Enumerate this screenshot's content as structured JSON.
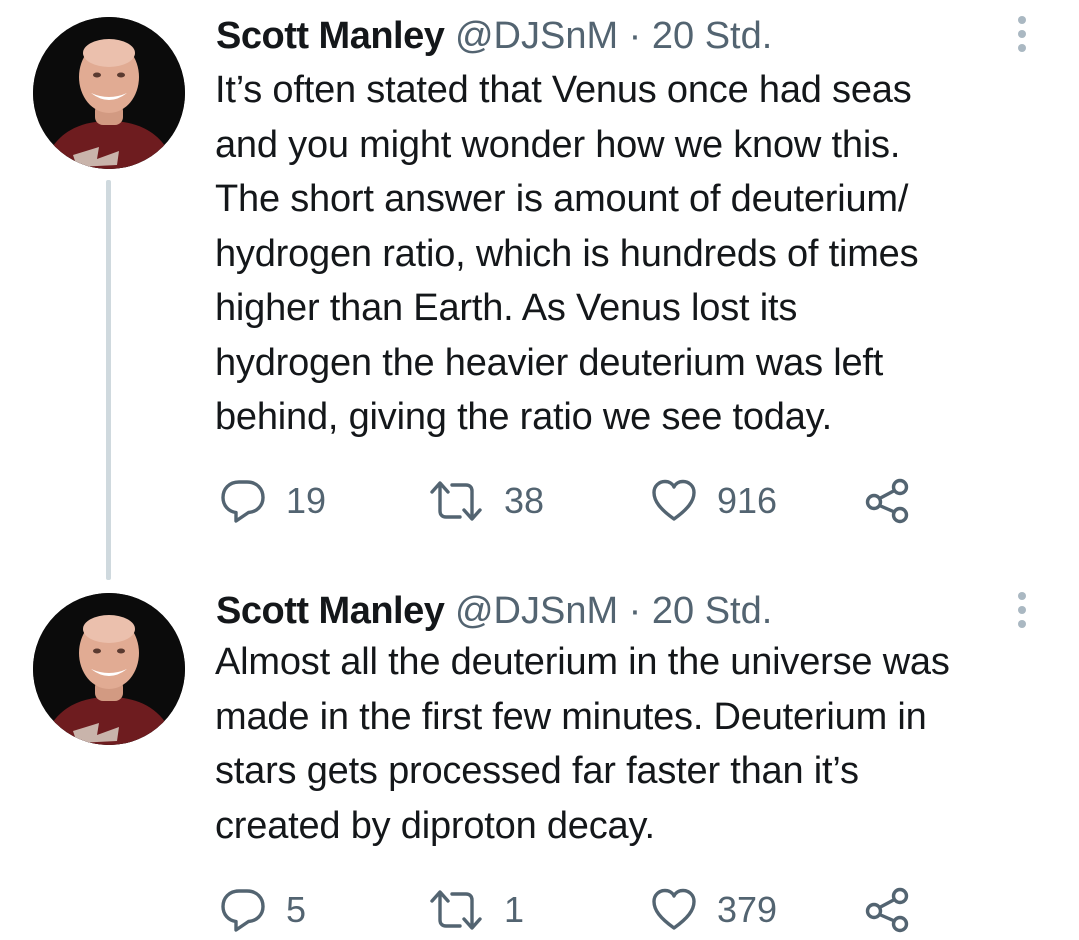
{
  "tweets": [
    {
      "author_name": "Scott Manley",
      "handle": "@DJSnM",
      "separator": "·",
      "time": "20 Std.",
      "text": "It’s often stated that Venus once had seas\nand you might wonder how we know this.\nThe short answer is amount of deuterium/\nhydrogen ratio, which is hundreds of times\nhigher than Earth. As Venus lost its\nhydrogen the heavier deuterium was left\nbehind, giving the ratio we see today.",
      "replies": "19",
      "retweets": "38",
      "likes": "916"
    },
    {
      "author_name": "Scott Manley",
      "handle": "@DJSnM",
      "separator": "·",
      "time": "20 Std.",
      "text": "Almost all the deuterium in the universe was\nmade in the first few minutes. Deuterium in\nstars gets processed far faster than it’s\ncreated by diproton decay.",
      "replies": "5",
      "retweets": "1",
      "likes": "379"
    }
  ],
  "icons": {
    "reply": "reply-icon",
    "retweet": "retweet-icon",
    "like": "heart-icon",
    "share": "share-icon",
    "more": "more-vertical-icon"
  },
  "colors": {
    "text": "#14171a",
    "secondary": "#536471",
    "thread_line": "#cfd9de"
  }
}
